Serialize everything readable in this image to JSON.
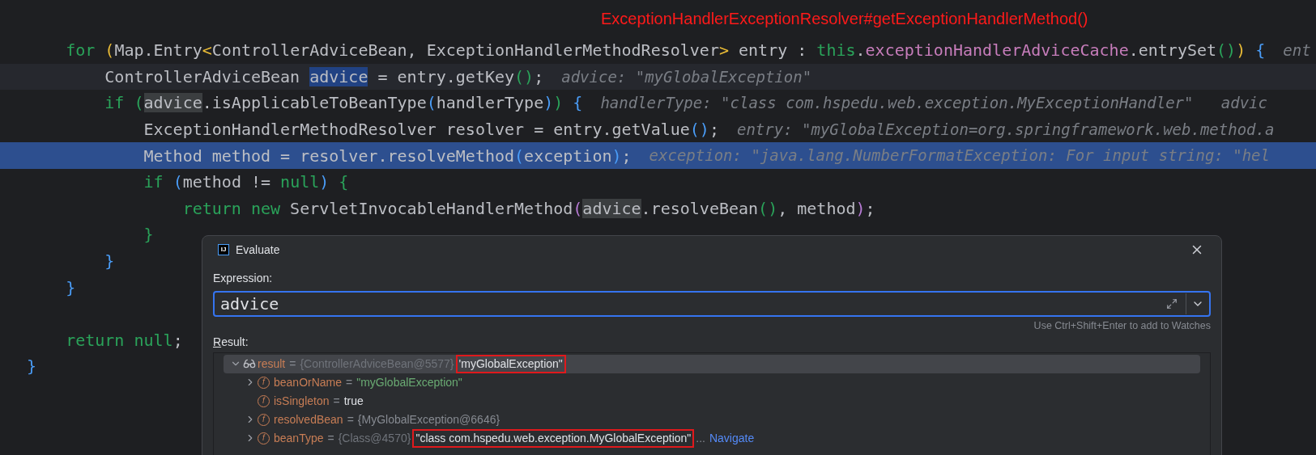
{
  "annotation": "ExceptionHandlerExceptionResolver#getExceptionHandlerMethod()",
  "code_lines": [
    {
      "kind": "plain",
      "tokens": [
        {
          "kind": "kw",
          "text": "    for "
        },
        {
          "kind": "b1",
          "text": "("
        },
        {
          "kind": "plain",
          "text": "Map.Entry"
        },
        {
          "kind": "b1",
          "text": "<"
        },
        {
          "kind": "plain",
          "text": "ControllerAdviceBean, ExceptionHandlerMethodResolver"
        },
        {
          "kind": "b1",
          "text": ">"
        },
        {
          "kind": "plain",
          "text": " entry : "
        },
        {
          "kind": "kw",
          "text": "this"
        },
        {
          "kind": "plain",
          "text": "."
        },
        {
          "kind": "field",
          "text": "exceptionHandlerAdviceCache"
        },
        {
          "kind": "plain",
          "text": ".entrySet"
        },
        {
          "kind": "b3",
          "text": "()"
        },
        {
          "kind": "b1",
          "text": ") "
        },
        {
          "kind": "b2",
          "text": "{"
        }
      ],
      "hint": "ent"
    },
    {
      "kind": "caret",
      "tokens": [
        {
          "kind": "plain",
          "text": "        ControllerAdviceBean "
        },
        {
          "kind": "selection",
          "text": "advice"
        },
        {
          "kind": "plain",
          "text": " = entry.getKey"
        },
        {
          "kind": "b3",
          "text": "()"
        },
        {
          "kind": "plain",
          "text": ";"
        }
      ],
      "hint": "advice: \"myGlobalException\""
    },
    {
      "kind": "plain",
      "tokens": [
        {
          "kind": "kw",
          "text": "        if "
        },
        {
          "kind": "b3",
          "text": "("
        },
        {
          "kind": "usage",
          "text": "advice"
        },
        {
          "kind": "plain",
          "text": ".isApplicableToBeanType"
        },
        {
          "kind": "b2",
          "text": "("
        },
        {
          "kind": "plain",
          "text": "handlerType"
        },
        {
          "kind": "b2",
          "text": ")"
        },
        {
          "kind": "b3",
          "text": ") "
        },
        {
          "kind": "b2",
          "text": "{"
        }
      ],
      "hint": "handlerType: \"class com.hspedu.web.exception.MyExceptionHandler\"   advic"
    },
    {
      "kind": "plain",
      "tokens": [
        {
          "kind": "plain",
          "text": "            ExceptionHandlerMethodResolver resolver = entry.getValue"
        },
        {
          "kind": "b2",
          "text": "()"
        },
        {
          "kind": "plain",
          "text": ";"
        }
      ],
      "hint": "entry: \"myGlobalException=org.springframework.web.method.a"
    },
    {
      "kind": "execution",
      "tokens": [
        {
          "kind": "plain",
          "text": "            Method method = resolver.resolveMethod"
        },
        {
          "kind": "b2",
          "text": "("
        },
        {
          "kind": "plain",
          "text": "exception"
        },
        {
          "kind": "b2",
          "text": ")"
        },
        {
          "kind": "plain",
          "text": ";"
        }
      ],
      "hint": "exception: \"java.lang.NumberFormatException: For input string: \"hel"
    },
    {
      "kind": "plain",
      "tokens": [
        {
          "kind": "kw",
          "text": "            if "
        },
        {
          "kind": "b2",
          "text": "("
        },
        {
          "kind": "plain",
          "text": "method != "
        },
        {
          "kind": "kw",
          "text": "null"
        },
        {
          "kind": "b2",
          "text": ") "
        },
        {
          "kind": "b3",
          "text": "{"
        }
      ]
    },
    {
      "kind": "plain",
      "tokens": [
        {
          "kind": "kw",
          "text": "                return new"
        },
        {
          "kind": "plain",
          "text": " ServletInvocableHandlerMethod"
        },
        {
          "kind": "b4",
          "text": "("
        },
        {
          "kind": "usage",
          "text": "advice"
        },
        {
          "kind": "plain",
          "text": ".resolveBean"
        },
        {
          "kind": "b3",
          "text": "()"
        },
        {
          "kind": "plain",
          "text": ", method"
        },
        {
          "kind": "b4",
          "text": ")"
        },
        {
          "kind": "plain",
          "text": ";"
        }
      ]
    },
    {
      "kind": "plain",
      "tokens": [
        {
          "kind": "b3",
          "text": "            }"
        }
      ]
    },
    {
      "kind": "plain",
      "tokens": [
        {
          "kind": "b2",
          "text": "        }"
        }
      ]
    },
    {
      "kind": "plain",
      "tokens": [
        {
          "kind": "b2",
          "text": "    }"
        }
      ]
    },
    {
      "kind": "plain"
    },
    {
      "kind": "plain",
      "tokens": [
        {
          "kind": "kw",
          "text": "    return null"
        },
        {
          "kind": "plain",
          "text": ";"
        }
      ]
    },
    {
      "kind": "plain",
      "tokens": [
        {
          "kind": "b2",
          "text": "}"
        }
      ]
    }
  ],
  "dialog": {
    "icon_text": "IJ",
    "title": "Evaluate",
    "expression_label": "Expression:",
    "expression": "advice",
    "watch_hint": "Use Ctrl+Shift+Enter to add to Watches",
    "result_label": "Result:",
    "tree": [
      {
        "kind": "watch",
        "expandable": true,
        "expanded": true,
        "selected": true,
        "name": "result",
        "equals": "=",
        "type": "{ControllerAdviceBean@5577}",
        "value": {
          "kind": "plain",
          "text": "'myGlobalException\""
        },
        "boxed": true,
        "children": [
          {
            "kind": "field",
            "icon_text": "f",
            "expandable": true,
            "expanded": false,
            "selected": false,
            "name": "beanOrName",
            "equals": "=",
            "value": {
              "kind": "string",
              "text": "\"myGlobalException\""
            },
            "boxed": false
          },
          {
            "kind": "field",
            "icon_text": "f",
            "expandable": false,
            "selected": false,
            "name": "isSingleton",
            "equals": "=",
            "value": {
              "kind": "plain",
              "text": "true"
            },
            "boxed": false
          },
          {
            "kind": "field",
            "icon_text": "f",
            "expandable": true,
            "expanded": false,
            "selected": false,
            "name": "resolvedBean",
            "equals": "=",
            "value": {
              "kind": "object",
              "text": "{MyGlobalException@6646}"
            },
            "boxed": false
          },
          {
            "kind": "field",
            "icon_text": "f",
            "expandable": true,
            "expanded": false,
            "selected": false,
            "name": "beanType",
            "equals": "=",
            "type": "{Class@4570}",
            "value": {
              "kind": "plain",
              "text": "\"class com.hspedu.web.exception.MyGlobalException\""
            },
            "boxed": true,
            "ellipsis": "...",
            "link": "Navigate"
          }
        ]
      }
    ]
  }
}
